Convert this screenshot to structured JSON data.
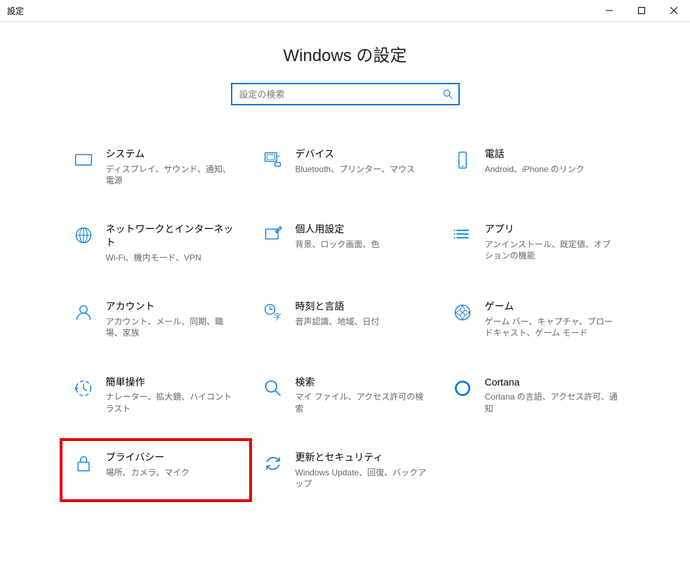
{
  "window": {
    "title": "設定"
  },
  "header": {
    "title": "Windows の設定"
  },
  "search": {
    "placeholder": "設定の検索"
  },
  "tiles": {
    "system": {
      "title": "システム",
      "desc": "ディスプレイ、サウンド、通知、電源"
    },
    "devices": {
      "title": "デバイス",
      "desc": "Bluetooth、プリンター、マウス"
    },
    "phone": {
      "title": "電話",
      "desc": "Android、iPhone のリンク"
    },
    "network": {
      "title": "ネットワークとインターネット",
      "desc": "Wi-Fi、機内モード、VPN"
    },
    "personalize": {
      "title": "個人用設定",
      "desc": "背景、ロック画面、色"
    },
    "apps": {
      "title": "アプリ",
      "desc": "アンインストール、既定値、オプションの機能"
    },
    "accounts": {
      "title": "アカウント",
      "desc": "アカウント、メール、同期、職場、家族"
    },
    "time": {
      "title": "時刻と言語",
      "desc": "音声認識、地域、日付"
    },
    "gaming": {
      "title": "ゲーム",
      "desc": "ゲーム バー、キャプチャ、ブロードキャスト、ゲーム モード"
    },
    "ease": {
      "title": "簡単操作",
      "desc": "ナレーター、拡大鏡、ハイコントラスト"
    },
    "searchtile": {
      "title": "検索",
      "desc": "マイ ファイル、アクセス許可の検索"
    },
    "cortana": {
      "title": "Cortana",
      "desc": "Cortana の言語、アクセス許可、通知"
    },
    "privacy": {
      "title": "プライバシー",
      "desc": "場所、カメラ、マイク"
    },
    "update": {
      "title": "更新とセキュリティ",
      "desc": "Windows Update、回復、バックアップ"
    }
  }
}
